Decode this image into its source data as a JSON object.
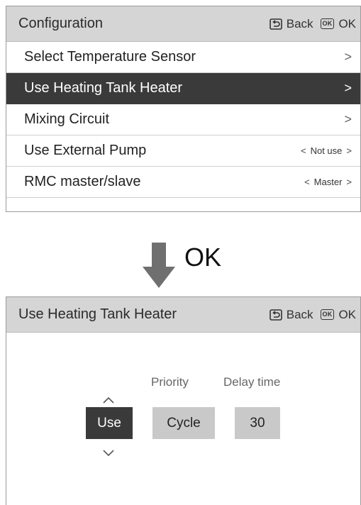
{
  "config_screen": {
    "title": "Configuration",
    "back_label": "Back",
    "ok_label": "OK",
    "ok_icon_text": "OK",
    "rows": [
      {
        "label": "Select Temperature Sensor",
        "chevron": ">"
      },
      {
        "label": "Use Heating Tank Heater",
        "chevron": ">"
      },
      {
        "label": "Mixing Circuit",
        "chevron": ">"
      },
      {
        "label": "Use External Pump",
        "left_arrow": "<",
        "value": "Not use",
        "right_arrow": ">"
      },
      {
        "label": "RMC master/slave",
        "left_arrow": "<",
        "value": "Master",
        "right_arrow": ">"
      }
    ]
  },
  "transition": {
    "label": "OK"
  },
  "heater_screen": {
    "title": "Use Heating Tank Heater",
    "back_label": "Back",
    "ok_label": "OK",
    "ok_icon_text": "OK",
    "priority_label": "Priority",
    "delay_label": "Delay time",
    "use_value": "Use",
    "priority_value": "Cycle",
    "delay_value": "30"
  }
}
